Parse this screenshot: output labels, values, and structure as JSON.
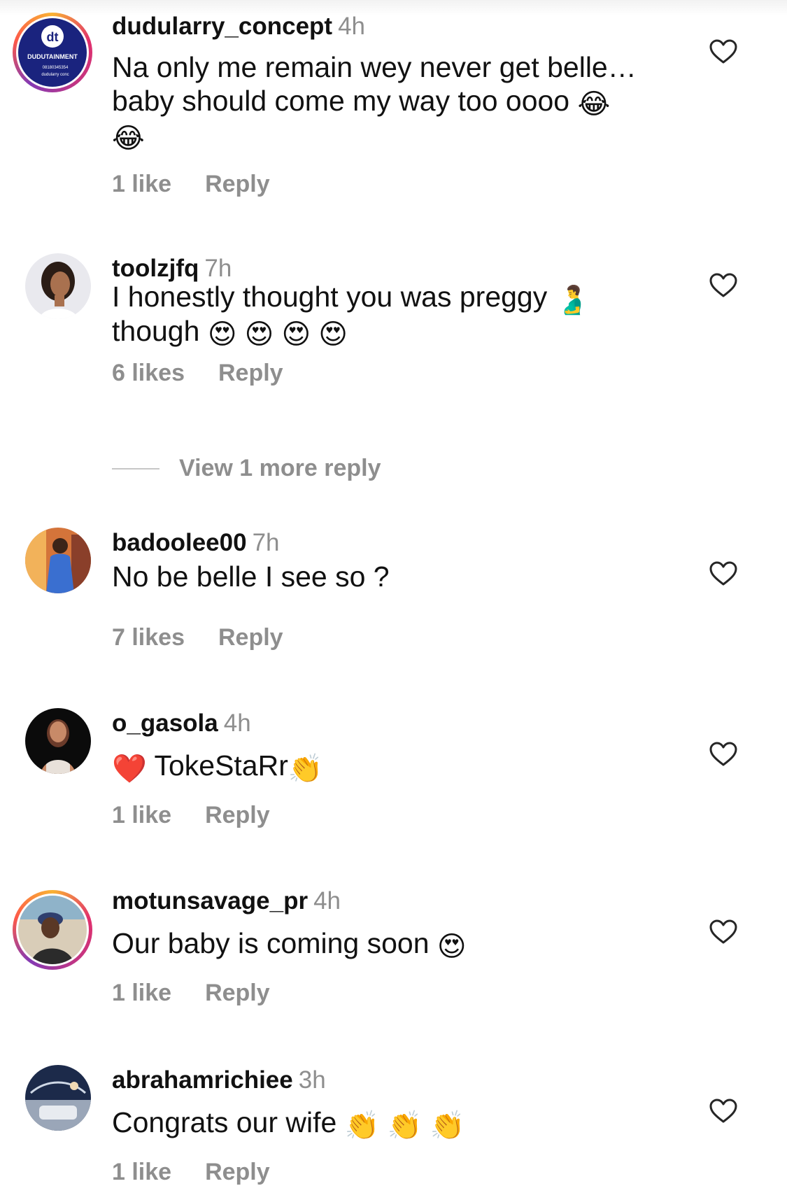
{
  "comments": [
    {
      "username": "dudularry_concept",
      "time": "4h",
      "text_line1": "Na only me remain wey never get belle…",
      "text_line2": "baby should come my way too oooo",
      "emoji_a": "😂",
      "emoji_b": "😂",
      "likes": "1 like",
      "reply": "Reply",
      "avatar_text": "DUDUTAINMENT",
      "avatar_phone": "08180345354",
      "avatar_handle": "dudularry conc",
      "avatar_logo": "dt"
    },
    {
      "username": "toolzjfq",
      "time": "7h",
      "text_line1": "I honestly thought you  was preggy",
      "emoji_a": "🫃",
      "text_line2": "though",
      "emoji_b": "😍 😍 😍 😍",
      "likes": "6 likes",
      "reply": "Reply"
    },
    {
      "username": "badoolee00",
      "time": "7h",
      "text": "No be belle I see so ?",
      "likes": "7 likes",
      "reply": "Reply"
    },
    {
      "username": "o_gasola",
      "time": "4h",
      "emoji_a": "❤️",
      "text": "TokeStaRr",
      "emoji_b": "👏",
      "likes": "1 like",
      "reply": "Reply"
    },
    {
      "username": "motunsavage_pr",
      "time": "4h",
      "text": "Our baby is coming soon",
      "emoji_a": "😍",
      "likes": "1 like",
      "reply": "Reply"
    },
    {
      "username": "abrahamrichiee",
      "time": "3h",
      "text": "Congrats our wife",
      "emoji_a": "👏 👏 👏",
      "likes": "1 like",
      "reply": "Reply"
    }
  ],
  "view_more": "View 1 more reply",
  "icons": {
    "like": "heart-outline-icon"
  },
  "colors": {
    "secondary_text": "#8e8e8e",
    "primary_text": "#111111",
    "divider": "#c7c7c7"
  }
}
